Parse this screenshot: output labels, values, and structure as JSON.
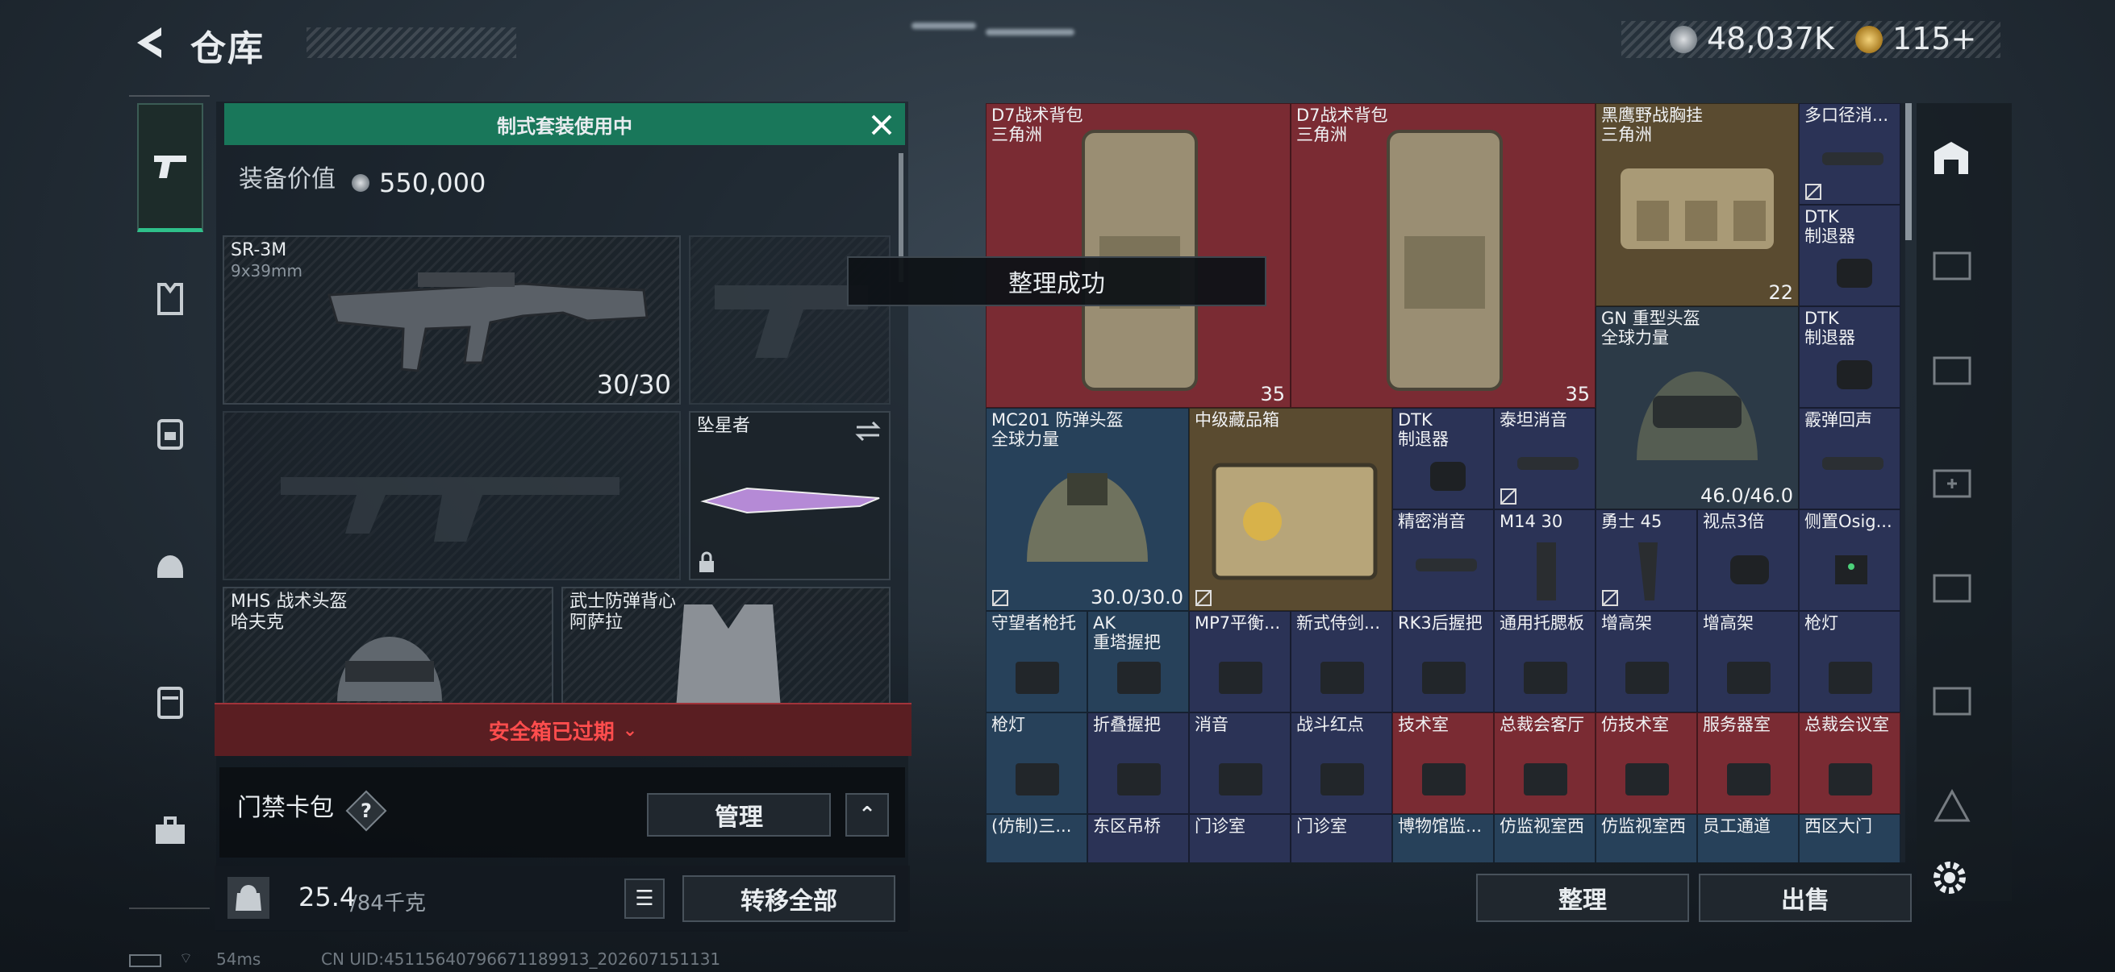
{
  "header": {
    "title": "仓库",
    "coins": "48,037K",
    "tokens": "115+"
  },
  "left": {
    "banner": "制式套装使用中",
    "equip_value_label": "装备价值",
    "equip_value": "550,000",
    "primary": {
      "name": "SR-3M",
      "caliber": "9x39mm",
      "ammo": "30/30"
    },
    "melee": {
      "name": "坠星者"
    },
    "helmet": {
      "name": "MHS 战术头盔",
      "brand": "哈夫克"
    },
    "armor": {
      "name": "武士防弹背心",
      "brand": "阿萨拉"
    },
    "warning": "安全箱已过期",
    "keycard": {
      "label": "门禁卡包",
      "help": "?",
      "manage": "管理"
    },
    "weight": {
      "current": "25.4",
      "max": "/84千克"
    },
    "transfer_all": "转移全部",
    "kg_label": "KG"
  },
  "toast": "整理成功",
  "grid": {
    "c1": {
      "n": "D7战术背包\n三角洲",
      "c": "35"
    },
    "c2": {
      "n": "D7战术背包\n三角洲",
      "c": "35"
    },
    "c3": {
      "n": "黑鹰野战胸挂\n三角洲",
      "c": "22"
    },
    "c4": {
      "n": "多口径消..."
    },
    "c5": {
      "n": "DTK\n制退器"
    },
    "c6": {
      "n": "GN 重型头盔\n全球力量",
      "c": "46.0/46.0"
    },
    "c7": {
      "n": "DTK\n制退器"
    },
    "c8": {
      "n": "MC201 防弹头盔\n全球力量",
      "c": "30.0/30.0"
    },
    "c9": {
      "n": "中级藏品箱"
    },
    "c10": {
      "n": "DTK\n制退器"
    },
    "c11": {
      "n": "泰坦消音"
    },
    "c12": {
      "n": "霰弹回声"
    },
    "c13": {
      "n": "精密消音"
    },
    "c14": {
      "n": "M14 30"
    },
    "c15": {
      "n": "勇士 45"
    },
    "c16": {
      "n": "视点3倍"
    },
    "c17": {
      "n": "侧置Osig..."
    },
    "r3": [
      "守望者枪托",
      "AK\n重塔握把",
      "MP7平衡...",
      "新式侍剑...",
      "RK3后握把",
      "通用托腮板",
      "增高架",
      "增高架",
      "枪灯"
    ],
    "r4": [
      "枪灯",
      "折叠握把",
      "消音",
      "战斗红点",
      "技术室",
      "总裁会客厅",
      "仿技术室",
      "服务器室",
      "总裁会议室"
    ],
    "r5": [
      "(仿制)三...",
      "东区吊桥",
      "门诊室",
      "门诊室",
      "博物馆监...",
      "仿监视室西",
      "仿监视室西",
      "员工通道",
      "西区大门"
    ]
  },
  "bottom": {
    "sort": "整理",
    "sell": "出售"
  },
  "status": {
    "ping": "54ms",
    "uid": "CN UID:451156407966711899​13_202607151131"
  }
}
